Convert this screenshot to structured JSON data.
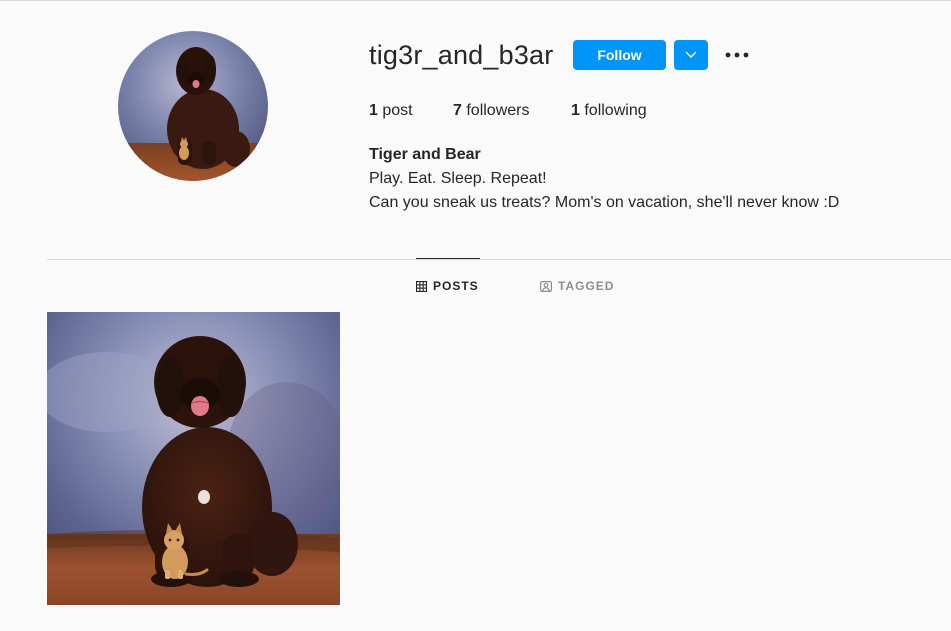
{
  "profile": {
    "username": "tig3r_and_b3ar",
    "follow_label": "Follow",
    "stats": {
      "posts_count": "1",
      "posts_label": " post",
      "followers_count": "7",
      "followers_label": " followers",
      "following_count": "1",
      "following_label": " following"
    },
    "bio": {
      "name": "Tiger and Bear",
      "line1": "Play. Eat. Sleep. Repeat!",
      "line2": "Can you sneak us treats? Mom's on vacation, she'll never know :D"
    }
  },
  "tabs": [
    {
      "label": "POSTS",
      "icon": "grid-icon",
      "active": true
    },
    {
      "label": "TAGGED",
      "icon": "tagged-icon",
      "active": false
    }
  ],
  "posts": [
    {
      "image": "newfoundland-dog-with-orange-kitten"
    }
  ],
  "colors": {
    "accent": "#0095f6",
    "text": "#262626",
    "muted": "#8e8e8e",
    "background": "#fafafa",
    "border": "#dbdbdb"
  }
}
